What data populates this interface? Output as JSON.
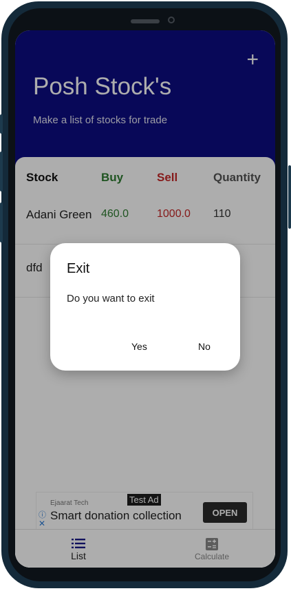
{
  "app": {
    "title": "Posh Stock's",
    "subtitle": "Make a list of stocks for trade",
    "add_symbol": "+"
  },
  "table": {
    "headers": [
      {
        "label": "Stock",
        "color": "#111111"
      },
      {
        "label": "Buy",
        "color": "#2e7d32"
      },
      {
        "label": "Sell",
        "color": "#c62828"
      },
      {
        "label": "Quantity",
        "color": "#555555"
      }
    ],
    "rows": [
      {
        "stock": "Adani Green",
        "buy": "460.0",
        "sell": "1000.0",
        "quantity": "110"
      },
      {
        "stock": "dfd",
        "buy": "",
        "sell": "",
        "quantity": ""
      }
    ]
  },
  "colors": {
    "header_bg": "#0c0c82",
    "buy": "#2e7d32",
    "sell": "#c62828"
  },
  "dialog": {
    "title": "Exit",
    "message": "Do you want to exit",
    "yes_label": "Yes",
    "no_label": "No"
  },
  "ad": {
    "brand": "Ejaarat Tech",
    "badge": "Test Ad",
    "title": "Smart donation collection",
    "button": "OPEN",
    "info_icon": "info-icon",
    "close_icon": "close-icon"
  },
  "bottom_nav": {
    "items": [
      {
        "label": "List",
        "icon": "list-icon"
      },
      {
        "label": "Calculate",
        "icon": "calculator-icon"
      }
    ]
  }
}
